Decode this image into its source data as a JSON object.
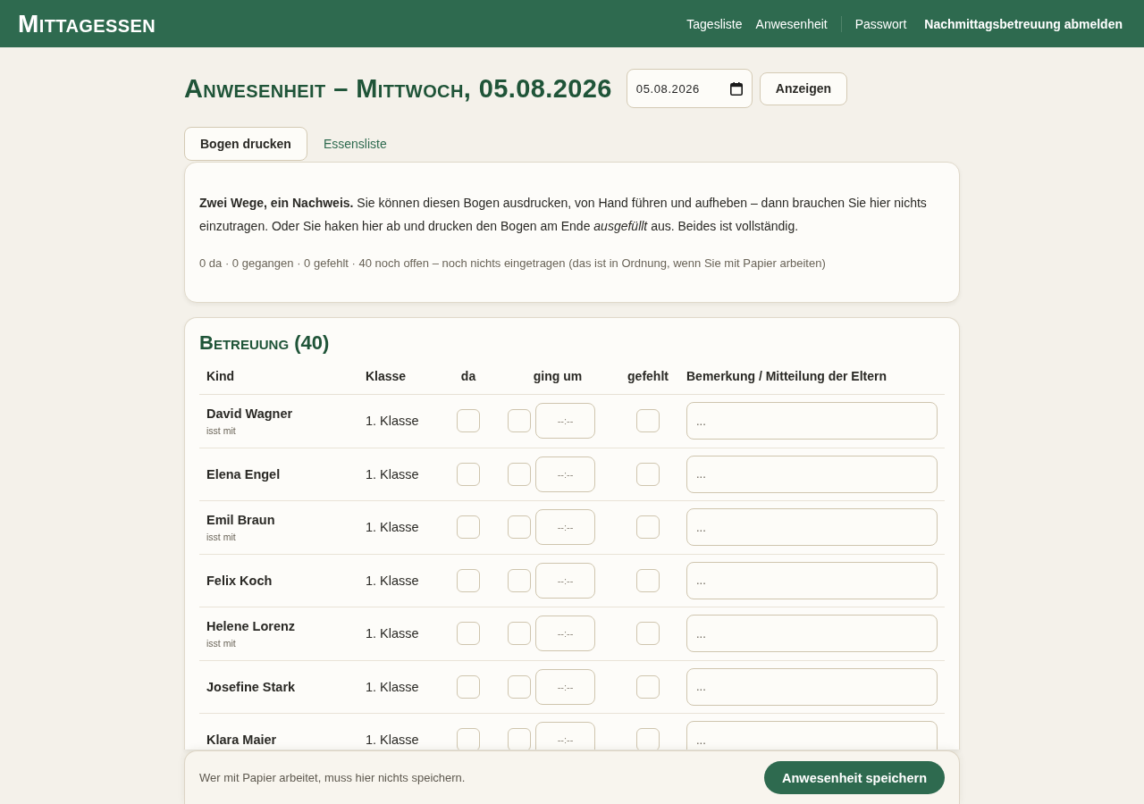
{
  "header": {
    "logo": "Mittagessen",
    "nav_pages": [
      {
        "label": "Tagesliste"
      },
      {
        "label": "Anwesenheit"
      }
    ],
    "nav_account": [
      {
        "label": "Passwort",
        "kind": "link"
      },
      {
        "label": "Nachmittagsbetreuung abmelden",
        "kind": "logout"
      }
    ]
  },
  "title": "Anwesenheit – Mittwoch, 05.08.2026",
  "date_field": {
    "value": "05.08.2026"
  },
  "show_button": "Anzeigen",
  "tabs": [
    {
      "label": "Bogen drucken",
      "selected": true
    },
    {
      "label": "Essensliste",
      "selected": false
    }
  ],
  "info": {
    "text": "**Zwei Wege, ein Nachweis.** Sie können diesen Bogen ausdrucken, von Hand führen und aufheben – dann brauchen Sie hier nichts einzutragen. Oder Sie haken hier ab und drucken den Bogen am Ende *ausgefüllt* aus. Beides ist vollständig.",
    "stats": "0 da · 0 gegangen · 0 gefehlt · 40 noch offen – noch nichts eingetragen (das ist in Ordnung, wenn Sie mit Papier arbeiten)"
  },
  "attendance": {
    "title": "Betreuung (40)",
    "columns": [
      "Kind",
      "Klasse",
      "da",
      "ging um",
      "gefehlt",
      "Bemerkung / Mitteilung der Eltern"
    ],
    "rows": [
      {
        "name": "David Wagner",
        "note": "isst mit",
        "class": "1. Klasse",
        "present": {
          "checked": false
        },
        "left": {
          "checked": false,
          "time_placeholder": "--:--"
        },
        "absent": {
          "checked": false
        },
        "remark_placeholder": "..."
      },
      {
        "name": "Elena Engel",
        "class": "1. Klasse",
        "present": {
          "checked": false
        },
        "left": {
          "checked": false,
          "time_placeholder": "--:--"
        },
        "absent": {
          "checked": false
        },
        "remark_placeholder": "..."
      },
      {
        "name": "Emil Braun",
        "note": "isst mit",
        "class": "1. Klasse",
        "present": {
          "checked": false
        },
        "left": {
          "checked": false,
          "time_placeholder": "--:--"
        },
        "absent": {
          "checked": false
        },
        "remark_placeholder": "..."
      },
      {
        "name": "Felix Koch",
        "class": "1. Klasse",
        "present": {
          "checked": false
        },
        "left": {
          "checked": false,
          "time_placeholder": "--:--"
        },
        "absent": {
          "checked": false
        },
        "remark_placeholder": "..."
      },
      {
        "name": "Helene Lorenz",
        "note": "isst mit",
        "class": "1. Klasse",
        "present": {
          "checked": false
        },
        "left": {
          "checked": false,
          "time_placeholder": "--:--"
        },
        "absent": {
          "checked": false
        },
        "remark_placeholder": "..."
      },
      {
        "name": "Josefine Stark",
        "class": "1. Klasse",
        "present": {
          "checked": false
        },
        "left": {
          "checked": false,
          "time_placeholder": "--:--"
        },
        "absent": {
          "checked": false
        },
        "remark_placeholder": "..."
      },
      {
        "name": "Klara Maier",
        "class": "1. Klasse",
        "present": {
          "checked": false
        },
        "left": {
          "checked": false,
          "time_placeholder": "--:--"
        },
        "absent": {
          "checked": false
        },
        "remark_placeholder": "..."
      }
    ]
  },
  "save_bar": {
    "hint": "Wer mit Papier arbeitet, muss hier nichts speichern.",
    "button": "Anwesenheit speichern"
  }
}
